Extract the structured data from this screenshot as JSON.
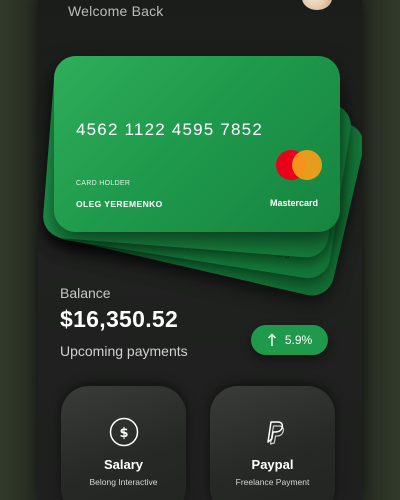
{
  "header": {
    "welcome": "Welcome Back"
  },
  "cards": {
    "back_label": "Mastercard",
    "front": {
      "number": "4562 1122 4595 7852",
      "holder_caption": "CARD HOLDER",
      "holder_name": "OLEG YEREMENKO",
      "brand": "Mastercard",
      "logo_icon": "mastercard-logo",
      "color": "#1f9a4c"
    }
  },
  "balance": {
    "label": "Balance",
    "amount": "$16,350.52",
    "change": "5.9%",
    "change_icon": "arrow-up-icon"
  },
  "upcoming": {
    "label": "Upcoming payments"
  },
  "payments": [
    {
      "title": "Salary",
      "subtitle": "Belong Interactive",
      "icon": "dollar-icon"
    },
    {
      "title": "Paypal",
      "subtitle": "Freelance Payment",
      "icon": "paypal-icon"
    }
  ],
  "colors": {
    "accent": "#1f9a4c",
    "background": "#1e1f1e",
    "mastercard_red": "#eb001b",
    "mastercard_yellow": "#f79e1b"
  }
}
